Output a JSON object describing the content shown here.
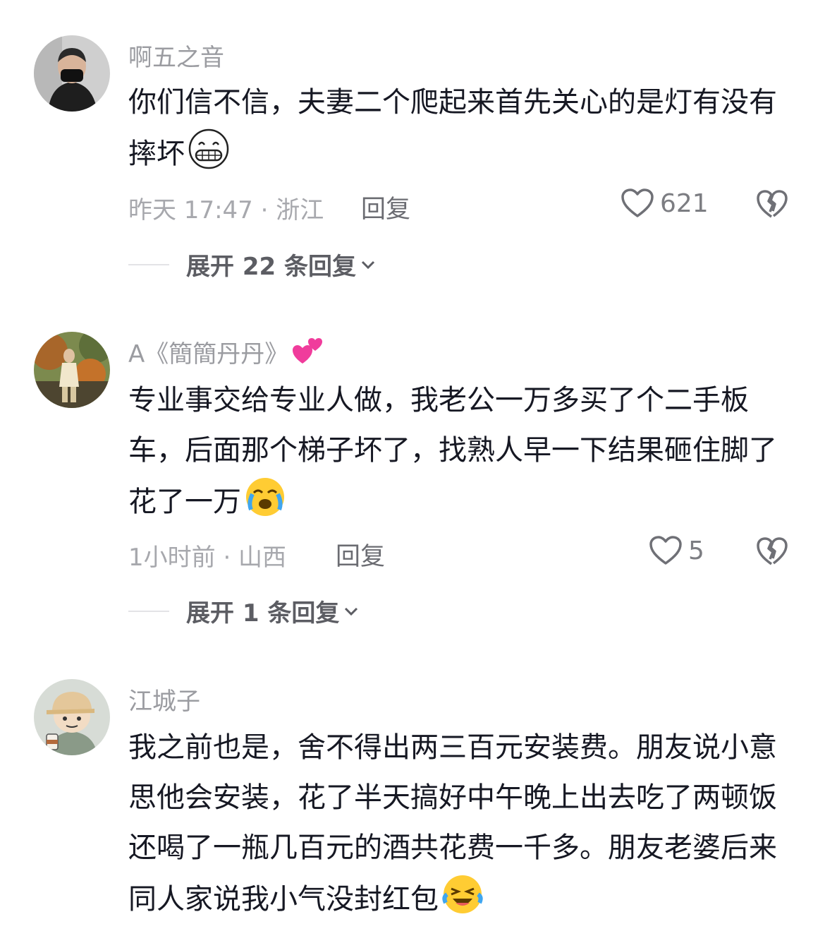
{
  "comments": [
    {
      "username": "啊五之音",
      "text": "你们信不信，夫妻二个爬起来首先关心的是灯有没有摔坏",
      "emoji": "grinning-emoji",
      "time_location": "昨天 17:47 · 浙江",
      "reply_label": "回复",
      "likes": "621",
      "expand_label": "展开 22 条回复"
    },
    {
      "username": "A《簡簡丹丹》",
      "username_emoji": "two-hearts-emoji",
      "text": "专业事交给专业人做，我老公一万多买了个二手板车，后面那个梯子坏了，找熟人早一下结果砸住脚了花了一万",
      "emoji": "crying-emoji",
      "time_location": "1小时前 · 山西",
      "reply_label": "回复",
      "likes": "5",
      "expand_label": "展开 1 条回复"
    },
    {
      "username": "江城子",
      "text": "我之前也是，舍不得出两三百元安装费。朋友说小意思他会安装，花了半天搞好中午晚上出去吃了两顿饭还喝了一瓶几百元的酒共花费一千多。朋友老婆后来同人家说我小气没封红包",
      "emoji": "laughing-tears-emoji"
    }
  ],
  "colors": {
    "text": "#161823",
    "meta": "#a7a8ad",
    "username": "#9b9ca1",
    "icon": "#6f7076"
  }
}
